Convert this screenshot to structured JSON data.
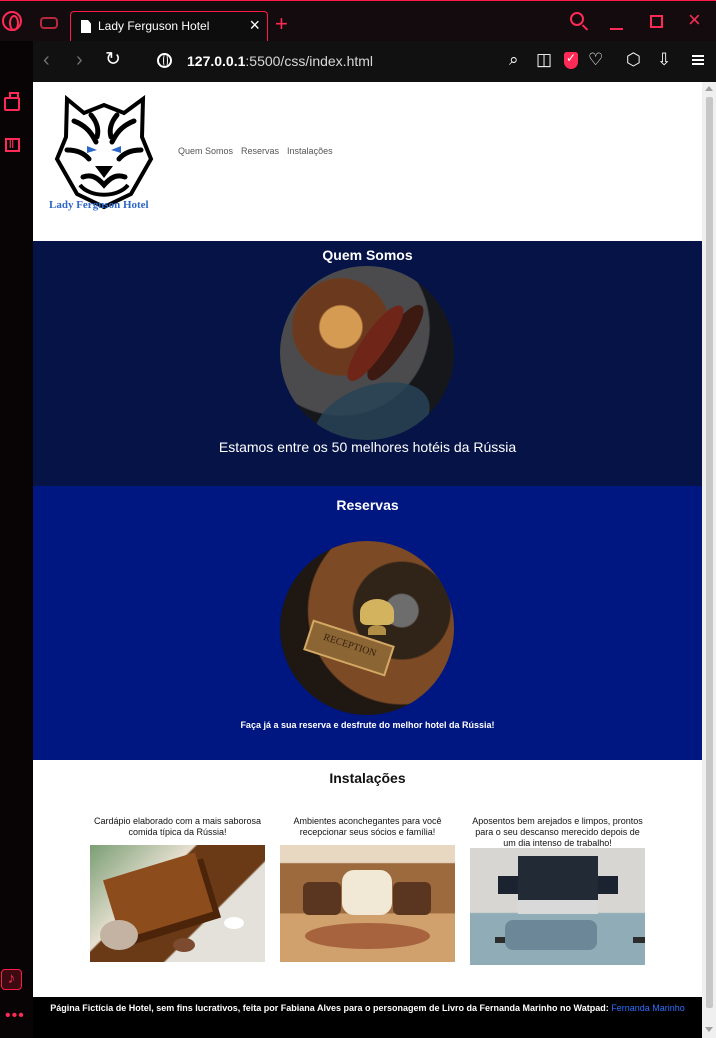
{
  "browser": {
    "tab_title": "Lady Ferguson Hotel",
    "tab_close": "×",
    "tab_add": "+",
    "close_window": "×",
    "url_host": "127.0.0.1",
    "url_rest": ":5500/css/index.html",
    "icons": [
      "opera-icon",
      "gamepad-icon",
      "document-icon",
      "back-icon",
      "forward-icon",
      "reload-icon",
      "site-info-icon",
      "search-icon",
      "camera-icon",
      "shield-icon",
      "heart-icon",
      "box-icon",
      "download-icon",
      "settings-icon",
      "shopping-bag-icon",
      "twitch-icon",
      "music-icon",
      "more-icon"
    ]
  },
  "site": {
    "logo_text": "Lady Ferguson Hotel",
    "nav": [
      "Quem Somos",
      "Reservas",
      "Instalações"
    ],
    "about": {
      "title": "Quem Somos",
      "caption": "Estamos entre os 50 melhores hotéis da Rússia"
    },
    "reservas": {
      "title": "Reservas",
      "caption": "Faça já a sua reserva e desfrute do melhor hotel da Rússia!"
    },
    "installations": {
      "title": "Instalações",
      "cards": [
        "Cardápio elaborado com a mais saborosa comida típica da Rússia!",
        "Ambientes aconchegantes para você recepcionar seus sócios e família!",
        "Aposentos bem arejados e limpos, prontos para o seu descanso merecido depois de um dia intenso de trabalho!"
      ]
    },
    "footer": {
      "text": "Página Fictícia de Hotel, sem fins lucrativos, feita por Fabiana Alves para o personagem de Livro da Fernanda Marinho no Watpad: ",
      "link": "Fernanda Marinho"
    }
  },
  "colors": {
    "opera_red": "#ff2a55",
    "about_bg": "#061347",
    "reservas_bg": "#001680",
    "logo_blue": "#2d67c6"
  }
}
